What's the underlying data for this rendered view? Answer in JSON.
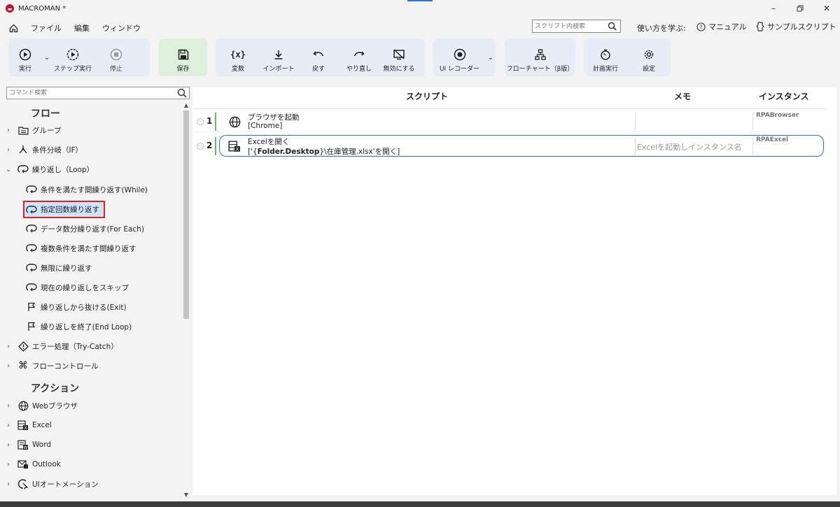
{
  "window": {
    "title": "MACROMAN *"
  },
  "menu": {
    "items": [
      "ファイル",
      "編集",
      "ウィンドウ"
    ],
    "search_placeholder": "スクリプト内検索",
    "help_label": "使い方を学ぶ:",
    "manual_label": "マニュアル",
    "sample_label": "サンプルスクリプト"
  },
  "toolbar": {
    "run": "実行",
    "step_run": "ステップ実行",
    "stop": "停止",
    "save": "保存",
    "variables": "変数",
    "import": "インポート",
    "undo": "戻す",
    "redo": "やり直し",
    "disable": "無効にする",
    "ui_recorder": "UI レコーダー",
    "flowchart": "フローチャート（β版）",
    "scheduled_run": "計画実行",
    "settings": "設定"
  },
  "commands": {
    "search_placeholder": "コマンド検索",
    "flow_title": "フロー",
    "action_title": "アクション",
    "flow_items": [
      "グループ",
      "条件分岐（IF）",
      "繰り返し（Loop）"
    ],
    "loop_children": [
      "条件を満たす間繰り返す(While)",
      "指定回数繰り返す",
      "データ数分繰り返す(For Each)",
      "複数条件を満たす間繰り返す",
      "無限に繰り返す",
      "現在の繰り返しをスキップ",
      "繰り返しから抜ける(Exit)",
      "繰り返しを終了(End Loop)"
    ],
    "flow_items_after": [
      "エラー処理（Try-Catch）",
      "フローコントロール"
    ],
    "action_items": [
      "Webブラウザ",
      "Excel",
      "Word",
      "Outlook",
      "UIオートメーション"
    ]
  },
  "script": {
    "headers": {
      "script": "スクリプト",
      "memo": "メモ",
      "instance": "インスタンス"
    },
    "rows": [
      {
        "num": "1",
        "title": "ブラウザを起動",
        "detail": "[Chrome]",
        "memo": "",
        "instance": "RPABrowser",
        "icon": "globe-icon"
      },
      {
        "num": "2",
        "title": "Excelを開く",
        "detail_prefix": "['{",
        "detail_bold": "Folder.Desktop",
        "detail_suffix": "}\\在庫管理.xlsx'を開く]",
        "memo": "Excelを起動しインスタンス名",
        "instance": "RPAExcel",
        "icon": "excel-icon"
      }
    ]
  },
  "colors": {
    "accent_blue": "#2a6fd0",
    "toolbar_group_bg": "#e7edf7",
    "save_group_bg": "#dcf0dc",
    "selected_border": "#d9261c",
    "row_bar_green": "#5cc060"
  }
}
